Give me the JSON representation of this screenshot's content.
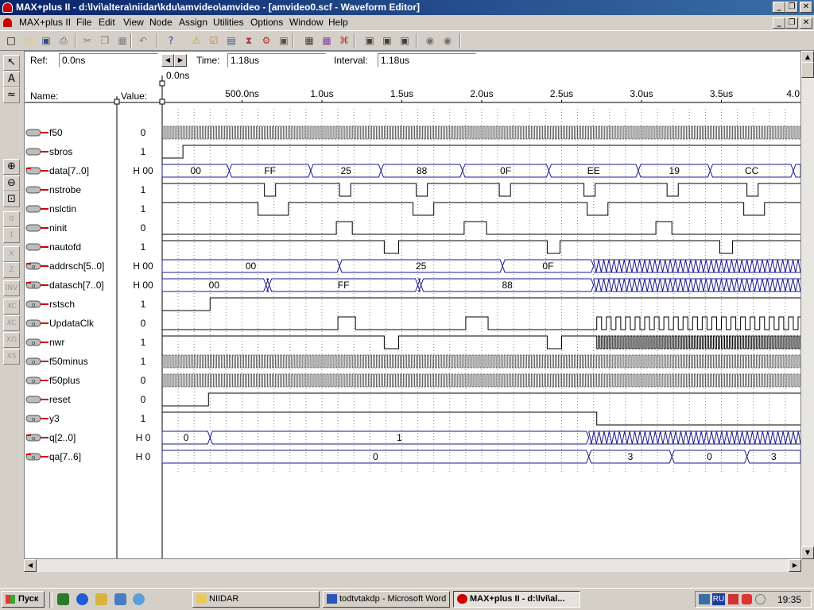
{
  "app_title": "MAX+plus II - d:\\lvi\\altera\\niidar\\kdu\\amvideo\\amvideo - [amvideo0.scf - Waveform Editor]",
  "window_controls": {
    "minimize": "_",
    "restore": "❐",
    "close": "✕"
  },
  "menu": [
    "MAX+plus II",
    "File",
    "Edit",
    "View",
    "Node",
    "Assign",
    "Utilities",
    "Options",
    "Window",
    "Help"
  ],
  "toolbar_icons": [
    "new-icon",
    "open-icon",
    "save-icon",
    "print-icon",
    "cut-icon",
    "copy-icon",
    "paste-icon",
    "undo-icon",
    "help-pointer-icon",
    "hierarchy-up-icon",
    "compile-icon",
    "simulate-icon",
    "timing-icon",
    "program-icon",
    "project-save-icon",
    "hierarchy-display-icon",
    "floorplan-icon",
    "compiler-icon",
    "simulator-icon",
    "timing-analyzer-icon",
    "programmer-icon",
    "report-icon",
    "find-icon"
  ],
  "left_tools": [
    "selection-tool",
    "text-tool",
    "waveform-draw-tool",
    "zoom-in-tool",
    "zoom-out-tool",
    "fit-in-window-tool",
    "force-0-tool",
    "force-1-tool",
    "force-x-tool",
    "force-z-tool",
    "invert-tool",
    "overwrite-count-tool",
    "overwrite-clock-tool",
    "overwrite-group-tool",
    "overwrite-state-tool"
  ],
  "left_tool_labels": [
    "↖",
    "A",
    "≈",
    "⊕",
    "⊖",
    "⊡",
    "0",
    "1",
    "X",
    "Z",
    "INV",
    "XC",
    "XC",
    "XG",
    "XS"
  ],
  "time_bar": {
    "ref_label": "Ref:",
    "ref_value": "0.0ns",
    "time_label": "Time:",
    "time_value": "1.18us",
    "interval_label": "Interval:",
    "interval_value": "1.18us",
    "start_marker": "0.0ns"
  },
  "columns": {
    "name": "Name:",
    "value": "Value:"
  },
  "time_axis": {
    "end_us": 4.0,
    "ticks": [
      {
        "t": 0.5,
        "label": "500.0ns"
      },
      {
        "t": 1.0,
        "label": "1.0us"
      },
      {
        "t": 1.5,
        "label": "1.5us"
      },
      {
        "t": 2.0,
        "label": "2.0us"
      },
      {
        "t": 2.5,
        "label": "2.5us"
      },
      {
        "t": 3.0,
        "label": "3.0us"
      },
      {
        "t": 3.5,
        "label": "3.5us"
      },
      {
        "t": 4.0,
        "label": "4.0"
      }
    ]
  },
  "signals": [
    {
      "name": "f50",
      "value": "0",
      "kind": "input",
      "wave": {
        "type": "fastclock",
        "period": 0.02,
        "init": 0
      }
    },
    {
      "name": "sbros",
      "value": "1",
      "kind": "input",
      "wave": {
        "type": "digital",
        "init": 0,
        "edges": [
          0.13
        ]
      }
    },
    {
      "name": "data[7..0]",
      "value": "H 00",
      "kind": "input-bus",
      "wave": {
        "type": "bus",
        "segments": [
          {
            "t1": 0,
            "t2": 0.42,
            "v": "00"
          },
          {
            "t1": 0.42,
            "t2": 0.93,
            "v": "FF"
          },
          {
            "t1": 0.93,
            "t2": 1.37,
            "v": "25"
          },
          {
            "t1": 1.37,
            "t2": 1.88,
            "v": "88"
          },
          {
            "t1": 1.88,
            "t2": 2.42,
            "v": "0F"
          },
          {
            "t1": 2.42,
            "t2": 2.98,
            "v": "EE"
          },
          {
            "t1": 2.98,
            "t2": 3.43,
            "v": "19"
          },
          {
            "t1": 3.43,
            "t2": 3.95,
            "v": "CC"
          },
          {
            "t1": 3.95,
            "t2": 4.0,
            "v": ""
          }
        ]
      }
    },
    {
      "name": "nstrobe",
      "value": "1",
      "kind": "input",
      "wave": {
        "type": "digital",
        "init": 1,
        "edges": [
          0.64,
          0.71,
          1.11,
          1.18,
          1.59,
          1.66,
          2.11,
          2.18,
          2.64,
          2.71,
          3.16,
          3.23,
          3.66,
          3.73
        ]
      }
    },
    {
      "name": "nslctin",
      "value": "1",
      "kind": "input",
      "wave": {
        "type": "digital",
        "init": 1,
        "edges": [
          0.6,
          0.79,
          1.57,
          1.7,
          2.66,
          2.79,
          3.64,
          3.77
        ]
      }
    },
    {
      "name": "ninit",
      "value": "0",
      "kind": "input",
      "wave": {
        "type": "digital",
        "init": 0,
        "edges": [
          1.09,
          1.19,
          1.89,
          2.03,
          3.09,
          3.19
        ]
      }
    },
    {
      "name": "nautofd",
      "value": "1",
      "kind": "input",
      "wave": {
        "type": "digital",
        "init": 1,
        "edges": [
          1.39,
          1.48,
          2.41,
          2.49,
          3.49,
          3.57
        ]
      }
    },
    {
      "name": "addrsch[5..0]",
      "value": "H 00",
      "kind": "output-bus",
      "wave": {
        "type": "bus",
        "segments": [
          {
            "t1": 0,
            "t2": 1.11,
            "v": "00"
          },
          {
            "t1": 1.11,
            "t2": 2.13,
            "v": "25"
          },
          {
            "t1": 2.13,
            "t2": 2.7,
            "v": "0F"
          }
        ],
        "dense_from": 2.7
      }
    },
    {
      "name": "datasch[7..0]",
      "value": "H 00",
      "kind": "output-bus",
      "wave": {
        "type": "bus",
        "segments": [
          {
            "t1": 0,
            "t2": 0.65,
            "v": "00"
          },
          {
            "t1": 0.65,
            "t2": 0.67,
            "v": ""
          },
          {
            "t1": 0.67,
            "t2": 1.6,
            "v": "FF"
          },
          {
            "t1": 1.6,
            "t2": 1.62,
            "v": ""
          },
          {
            "t1": 1.62,
            "t2": 2.7,
            "v": "88"
          }
        ],
        "dense_from": 2.7
      }
    },
    {
      "name": "rstsch",
      "value": "1",
      "kind": "output",
      "wave": {
        "type": "digital",
        "init": 0,
        "edges": [
          0.3
        ]
      }
    },
    {
      "name": "UpdataClk",
      "value": "0",
      "kind": "output",
      "wave": {
        "type": "digital",
        "init": 0,
        "edges": [
          1.1,
          1.21,
          1.9,
          2.04
        ],
        "clock_from": 2.72,
        "clock_period": 0.06
      }
    },
    {
      "name": "nwr",
      "value": "1",
      "kind": "output",
      "wave": {
        "type": "digital",
        "init": 1,
        "edges": [
          1.39,
          1.48,
          2.41,
          2.5
        ],
        "clock_from": 2.72,
        "clock_period": 0.02
      }
    },
    {
      "name": "f50minus",
      "value": "1",
      "kind": "output",
      "wave": {
        "type": "fastclock",
        "period": 0.02,
        "init": 1
      }
    },
    {
      "name": "f50plus",
      "value": "0",
      "kind": "output",
      "wave": {
        "type": "fastclock",
        "period": 0.02,
        "init": 0
      }
    },
    {
      "name": "reset",
      "value": "0",
      "kind": "input",
      "wave": {
        "type": "digital",
        "init": 0,
        "edges": [
          0.29
        ]
      }
    },
    {
      "name": "y3",
      "value": "1",
      "kind": "output",
      "wave": {
        "type": "digital",
        "init": 1,
        "edges": [
          2.72
        ]
      }
    },
    {
      "name": "q[2..0]",
      "value": "H 0",
      "kind": "output-bus",
      "wave": {
        "type": "bus",
        "segments": [
          {
            "t1": 0,
            "t2": 0.3,
            "v": "0"
          },
          {
            "t1": 0.3,
            "t2": 2.67,
            "v": "1"
          }
        ],
        "dense_from": 2.67
      }
    },
    {
      "name": "qa[7..6]",
      "value": "H 0",
      "kind": "output-bus",
      "wave": {
        "type": "bus",
        "segments": [
          {
            "t1": 0,
            "t2": 2.67,
            "v": "0"
          },
          {
            "t1": 2.67,
            "t2": 3.19,
            "v": "3"
          },
          {
            "t1": 3.19,
            "t2": 3.66,
            "v": "0"
          },
          {
            "t1": 3.66,
            "t2": 4.0,
            "v": "3"
          }
        ]
      }
    }
  ],
  "taskbar": {
    "start": "Пуск",
    "quick_launch": [
      "desktop-icon",
      "ie-icon",
      "outlook-icon",
      "media-icon",
      "search-icon"
    ],
    "tasks": [
      {
        "label": "NIIDAR",
        "icon": "folder-icon",
        "active": false
      },
      {
        "label": "todtvtakdp - Microsoft Word",
        "icon": "word-icon",
        "active": false
      },
      {
        "label": "MAX+plus II - d:\\lvi\\al...",
        "icon": "maxplus-icon",
        "active": true
      }
    ],
    "lang": "RU",
    "clock": "19:35"
  }
}
